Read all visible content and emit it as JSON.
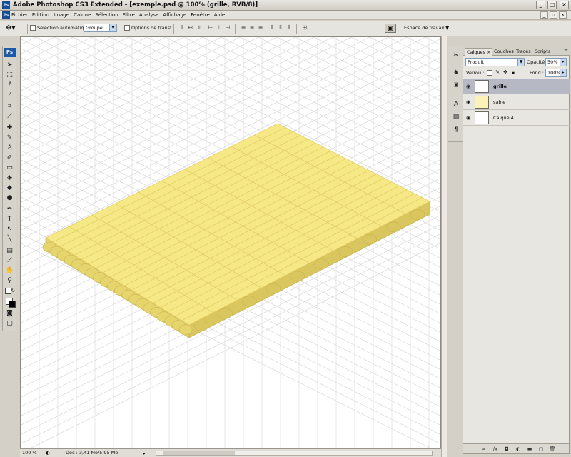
{
  "window": {
    "title": "Adobe Photoshop CS3 Extended - [exemple.psd @ 100% (grille, RVB/8)]",
    "app_icon_label": "Ps",
    "controls": [
      "minimize",
      "maximize",
      "close"
    ]
  },
  "menu": {
    "items": [
      "Fichier",
      "Edition",
      "Image",
      "Calque",
      "Sélection",
      "Filtre",
      "Analyse",
      "Affichage",
      "Fenêtre",
      "Aide"
    ]
  },
  "options": {
    "auto_select_label": "Sélection automatique :",
    "auto_select_value": "Groupe",
    "transform_label": "Options de transf.",
    "workspace_label": "Espace de travail ▼"
  },
  "toolbox": {
    "logo": "Ps",
    "tools": [
      "move-tool",
      "marquee-tool",
      "lasso-tool",
      "magic-wand-tool",
      "crop-tool",
      "eyedropper-tool",
      "healing-brush-tool",
      "brush-tool",
      "clone-stamp-tool",
      "history-brush-tool",
      "eraser-tool",
      "paint-bucket-tool",
      "blur-tool",
      "dodge-tool",
      "pen-tool",
      "type-tool",
      "path-selection-tool",
      "line-tool",
      "notes-tool",
      "eyedropper-tool-2",
      "hand-tool",
      "zoom-tool"
    ]
  },
  "layers_panel": {
    "tabs": [
      "Calques ×",
      "Couches",
      "Tracés",
      "Scripts"
    ],
    "blend_mode": "Produit",
    "opacity_label": "Opacité :",
    "opacity_value": "50%",
    "lock_label": "Verrou :",
    "fill_label": "Fond :",
    "fill_value": "100%",
    "layers": [
      {
        "name": "grille",
        "selected": true
      },
      {
        "name": "sable",
        "selected": false
      },
      {
        "name": "Calque 4",
        "selected": false
      }
    ]
  },
  "status": {
    "zoom": "100 %",
    "doc_info": "Doc : 3,41 Mo/5,95 Mo"
  },
  "colors": {
    "sand": "#f7e886",
    "sand_side": "#e6d46c",
    "grid_line": "#d7d7d7",
    "selected_layer": "#b6b9c4"
  }
}
